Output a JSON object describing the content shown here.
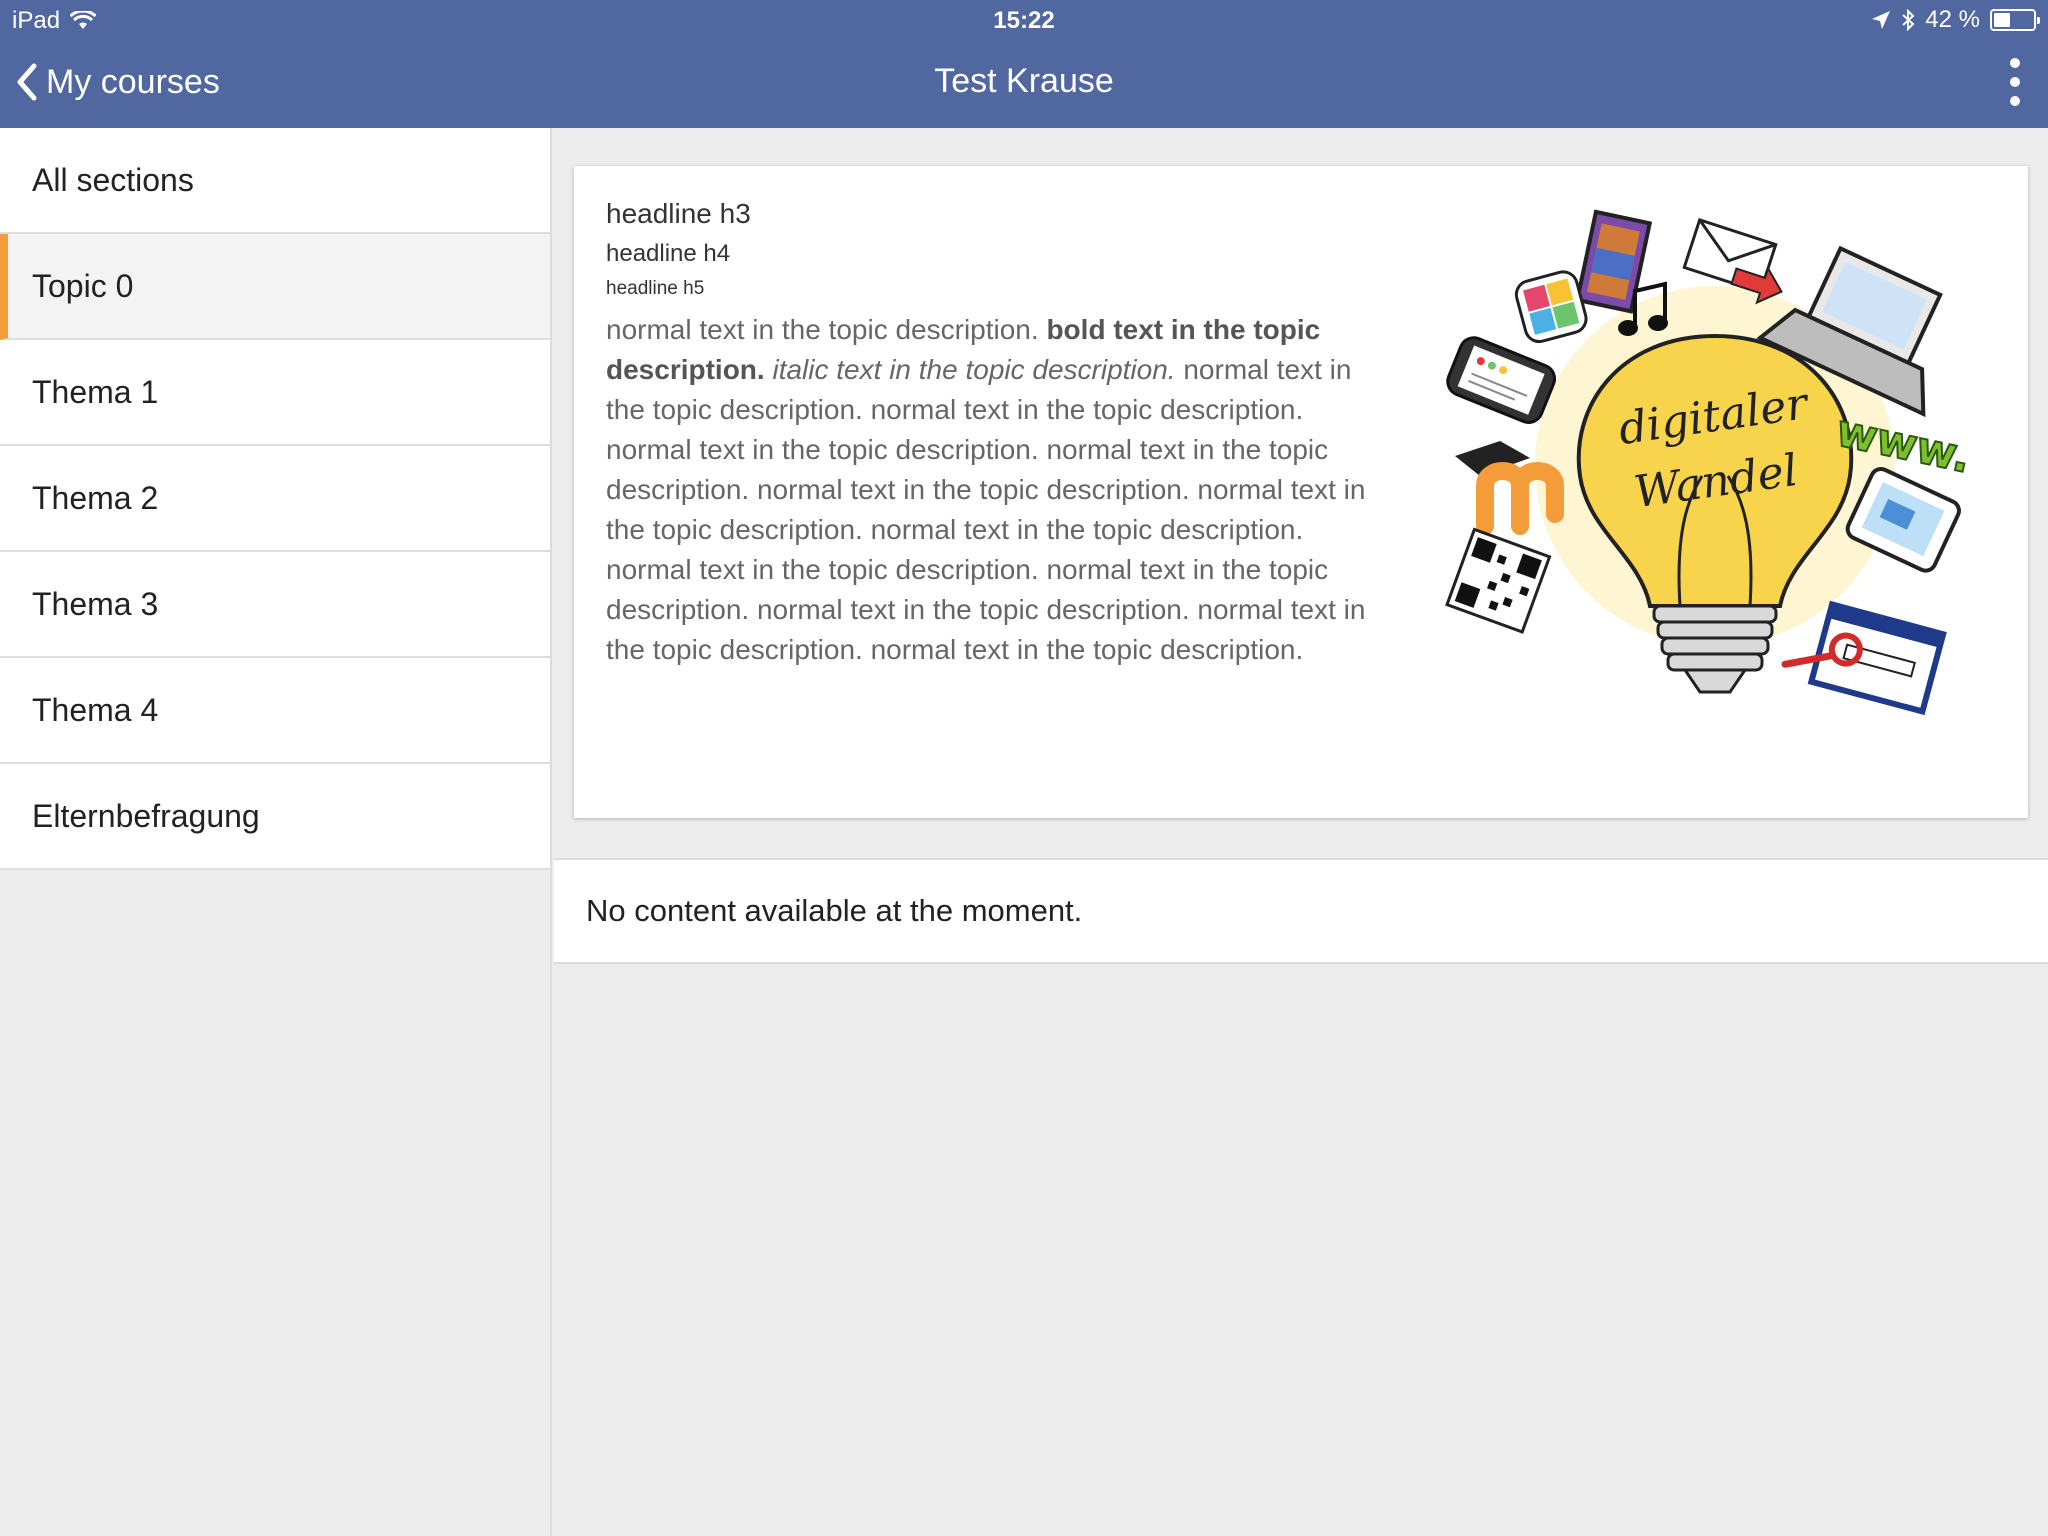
{
  "status": {
    "device": "iPad",
    "time": "15:22",
    "battery": "42 %",
    "battery_level": 0.42
  },
  "nav": {
    "back_label": "My courses",
    "title": "Test Krause"
  },
  "sidebar": {
    "items": [
      {
        "label": "All sections"
      },
      {
        "label": "Topic 0"
      },
      {
        "label": "Thema 1"
      },
      {
        "label": "Thema 2"
      },
      {
        "label": "Thema 3"
      },
      {
        "label": "Thema 4"
      },
      {
        "label": "Elternbefragung"
      }
    ],
    "active_index": 1
  },
  "topic": {
    "h3": "headline h3",
    "h4": "headline h4",
    "h5": "headline h5",
    "normal_1": "normal text in the topic description. ",
    "bold": "bold text in the topic description.",
    "italic": "italic text in the topic description.",
    "normal_rest": "normal text in the topic description. normal text in the topic description. normal text in the topic description. normal text in the topic description. normal text in the topic description. normal text in the topic description. normal text in the topic description. normal text in the topic description. normal text in the topic description. normal text in the topic description. normal text in the topic description. normal text in the topic description.",
    "image": {
      "lettering_line1": "digitaler",
      "lettering_line2": "Wandel",
      "www": "www."
    }
  },
  "empty_message": "No content available at the moment.",
  "colors": {
    "header": "#5167a0",
    "accent": "#f49b3a",
    "background": "#ededed"
  }
}
